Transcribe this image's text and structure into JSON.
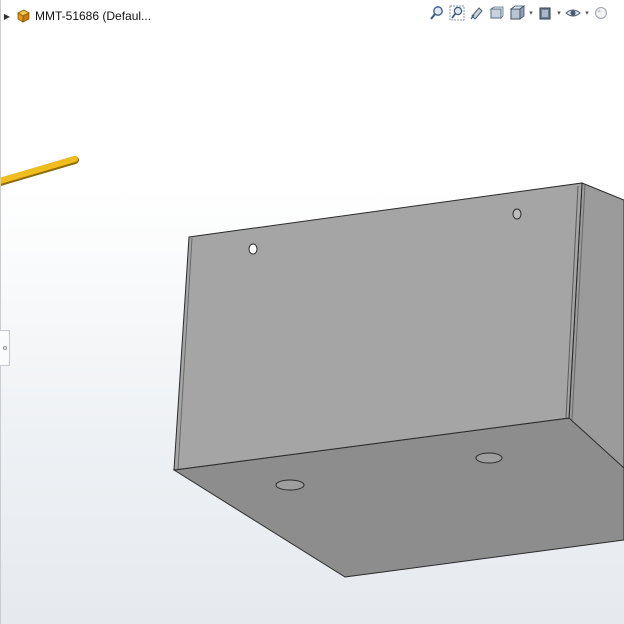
{
  "feature_tree": {
    "document_title": "MMT-51686 (Defaul...",
    "expand_icon": "chevron-right-icon",
    "part_icon": "part-document-icon"
  },
  "heads_up_toolbar": {
    "tools": [
      {
        "icon": "zoom-to-fit-icon"
      },
      {
        "icon": "zoom-to-area-icon"
      },
      {
        "icon": "previous-view-icon"
      },
      {
        "icon": "section-view-icon"
      },
      {
        "icon": "view-orientation-icon",
        "has_dropdown": true
      },
      {
        "icon": "display-style-icon",
        "has_dropdown": true
      },
      {
        "icon": "hide-show-items-icon",
        "has_dropdown": true
      },
      {
        "icon": "edit-appearance-icon"
      }
    ]
  },
  "colors": {
    "model_face_front": "#a4a4a4",
    "model_face_bottom": "#8c8c8c",
    "model_face_side": "#9a9a9a",
    "model_edge": "#2a2a2a",
    "triad_axis": "#e8b417"
  }
}
